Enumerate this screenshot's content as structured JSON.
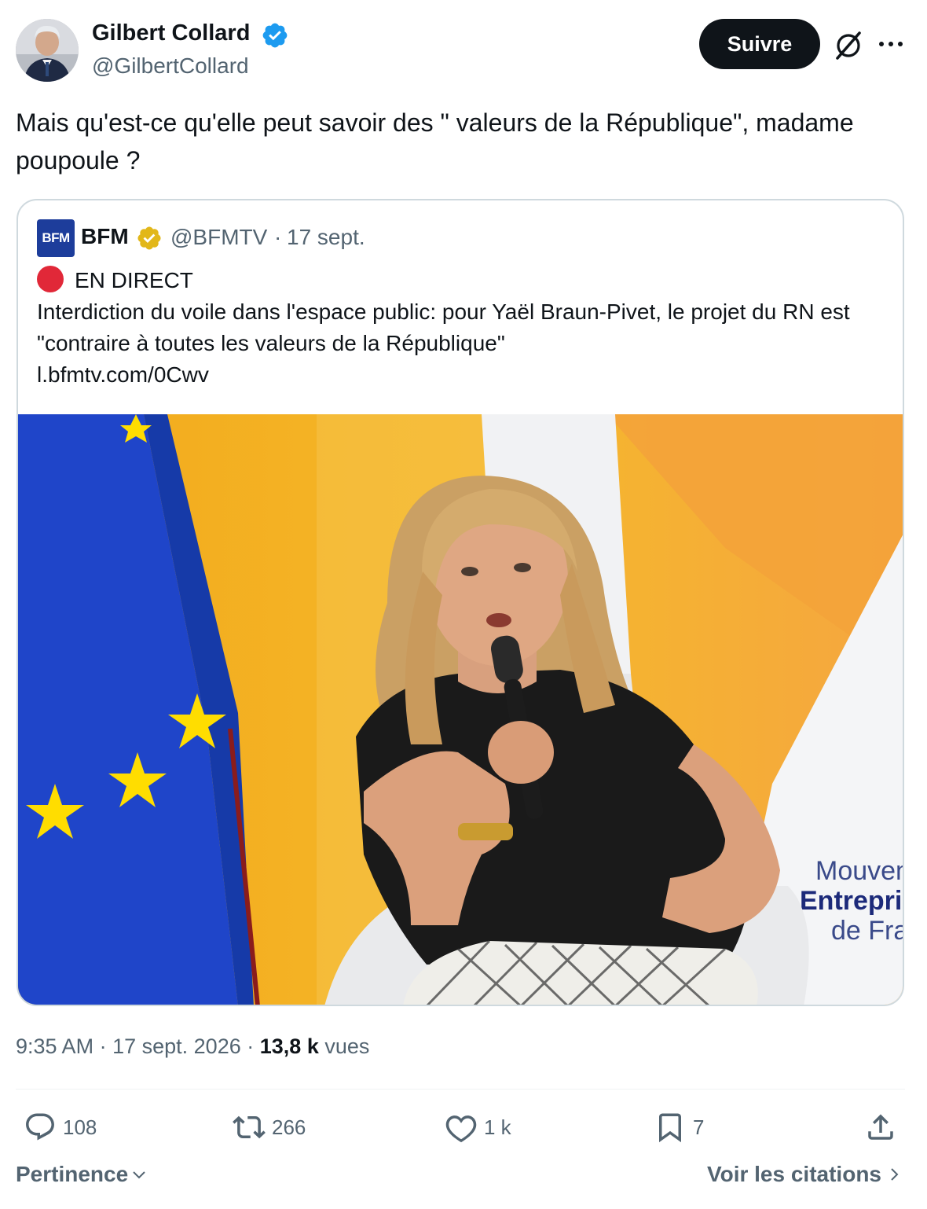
{
  "author": {
    "name": "Gilbert Collard",
    "handle": "@GilbertCollard",
    "avatar_icon": "portrait-photo"
  },
  "header": {
    "follow_label": "Suivre",
    "grok_icon": "grok-icon",
    "more_icon": "more-icon"
  },
  "tweet": {
    "text": "Mais qu'est-ce qu'elle peut savoir des \" valeurs de la République\", madame poupoule ?",
    "time": "9:35 AM",
    "date": "17 sept. 2026",
    "views_count": "13,8 k",
    "views_label": "vues",
    "separator": "·"
  },
  "quoted": {
    "logo_text": "BFM",
    "name": "BFM",
    "handle": "@BFMTV",
    "separator": "·",
    "date": "17 sept.",
    "live_label": "EN DIRECT",
    "body": "Interdiction du voile dans l'espace public: pour Yaël Braun-Pivet, le projet du RN est \"contraire à toutes les valeurs de la République\"",
    "link": "l.bfmtv.com/0Cwv",
    "photo_sign_lines": [
      "Mouvem",
      "Entrepri",
      "de Fra"
    ]
  },
  "actions": {
    "replies": "108",
    "reposts": "266",
    "likes": "1 k",
    "bookmarks": "7"
  },
  "footer": {
    "sort_label": "Pertinence",
    "quotes_label": "Voir les citations"
  },
  "colors": {
    "text_primary": "#0f1419",
    "text_secondary": "#536471",
    "verified_blue": "#1d9bf0",
    "verified_gold": "#e2b719",
    "bfm_blue": "#1d3d9b",
    "live_red": "#e12838",
    "border": "#cfd9de"
  }
}
